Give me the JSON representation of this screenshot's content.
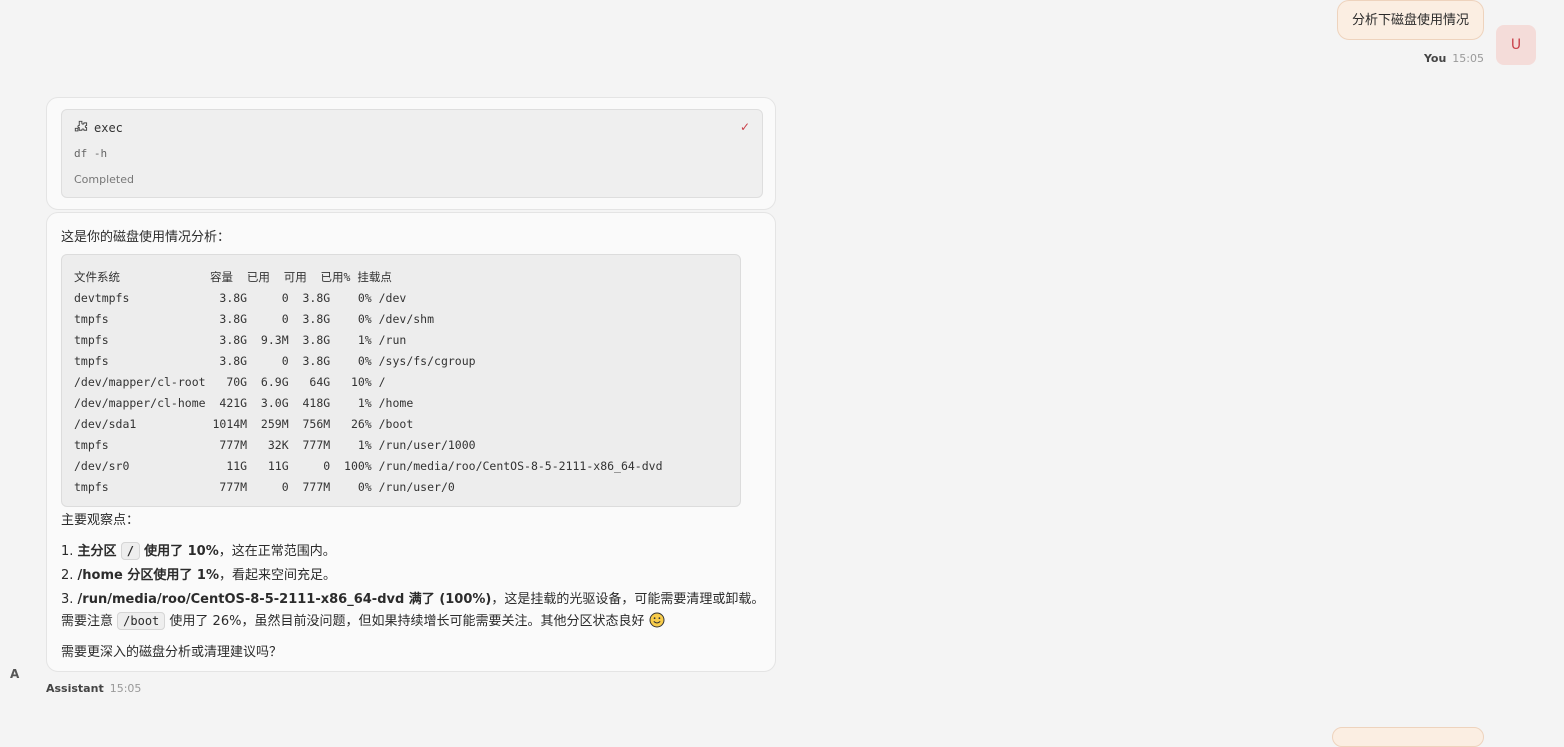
{
  "user_message": {
    "text": "分析下磁盘使用情况",
    "sender": "You",
    "time": "15:05",
    "avatar_letter": "U"
  },
  "tool_call": {
    "icon": "puzzle-icon",
    "name": "exec",
    "command": "df -h",
    "status": "Completed",
    "status_icon": "check-icon"
  },
  "assistant_message": {
    "intro": "这是你的磁盘使用情况分析：",
    "table_header": [
      "文件系统",
      "容量",
      "已用",
      "可用",
      "已用%",
      "挂载点"
    ],
    "table_rows": [
      [
        "devtmpfs",
        "3.8G",
        "0",
        "3.8G",
        "0%",
        "/dev"
      ],
      [
        "tmpfs",
        "3.8G",
        "0",
        "3.8G",
        "0%",
        "/dev/shm"
      ],
      [
        "tmpfs",
        "3.8G",
        "9.3M",
        "3.8G",
        "1%",
        "/run"
      ],
      [
        "tmpfs",
        "3.8G",
        "0",
        "3.8G",
        "0%",
        "/sys/fs/cgroup"
      ],
      [
        "/dev/mapper/cl-root",
        "70G",
        "6.9G",
        "64G",
        "10%",
        "/"
      ],
      [
        "/dev/mapper/cl-home",
        "421G",
        "3.0G",
        "418G",
        "1%",
        "/home"
      ],
      [
        "/dev/sda1",
        "1014M",
        "259M",
        "756M",
        "26%",
        "/boot"
      ],
      [
        "tmpfs",
        "777M",
        "32K",
        "777M",
        "1%",
        "/run/user/1000"
      ],
      [
        "/dev/sr0",
        "11G",
        "11G",
        "0",
        "100%",
        "/run/media/roo/CentOS-8-5-2111-x86_64-dvd"
      ],
      [
        "tmpfs",
        "777M",
        "0",
        "777M",
        "0%",
        "/run/user/0"
      ]
    ],
    "observations_title": "主要观察点：",
    "observations": [
      {
        "num": "1.",
        "bold_a": "主分区",
        "code": "/",
        "bold_b": "使用了 10%",
        "rest": "，这在正常范围内。"
      },
      {
        "num": "2.",
        "bold": "/home 分区使用了 1%",
        "rest": "，看起来空间充足。"
      },
      {
        "num": "3.",
        "bold": "/run/media/roo/CentOS-8-5-2111-x86_64-dvd 满了 (100%)",
        "rest": "，这是挂载的光驱设备，可能需要清理或卸载。"
      }
    ],
    "note_a": "需要注意",
    "note_code": "/boot",
    "note_b": "使用了 26%，虽然目前没问题，但如果持续增长可能需要关注。其他分区状态良好",
    "closing": "需要更深入的磁盘分析或清理建议吗？",
    "sender": "Assistant",
    "time": "15:05",
    "avatar_letter": "A"
  }
}
